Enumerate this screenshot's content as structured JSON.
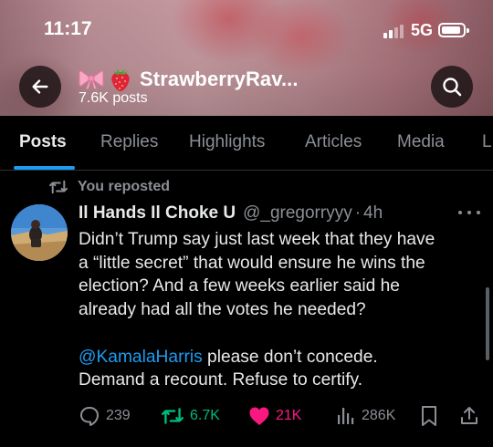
{
  "status_bar": {
    "time": "11:17",
    "network": "5G",
    "signal_bars_on": 2,
    "signal_bars_total": 4
  },
  "header": {
    "back_icon": "arrow-left-icon",
    "search_icon": "search-icon",
    "emoji_icons": [
      "bow-icon",
      "strawberry-icon"
    ],
    "profile_name": "StrawberryRav...",
    "post_count": "7.6K posts"
  },
  "tabs": [
    {
      "label": "Posts",
      "active": true
    },
    {
      "label": "Replies",
      "active": false
    },
    {
      "label": "Highlights",
      "active": false
    },
    {
      "label": "Articles",
      "active": false
    },
    {
      "label": "Media",
      "active": false
    },
    {
      "label": "L",
      "active": false
    }
  ],
  "post": {
    "repost_label": "You reposted",
    "author_name": "Il Hands Il Choke U",
    "author_handle": "@_gregorryyy",
    "separator": "·",
    "time": "4h",
    "text_lines": [
      "Didn’t Trump say just last week that they have",
      "a “little secret” that would ensure he wins the",
      "election? And a few weeks earlier said he",
      "already had all the votes he needed?"
    ],
    "mention": "@KamalaHarris",
    "line5_rest": " please don’t concede.",
    "line6": "Demand a recount. Refuse to certify.",
    "actions": {
      "replies": "239",
      "reposts": "6.7K",
      "likes": "21K",
      "views": "286K"
    }
  },
  "colors": {
    "accent": "#1d9bf0",
    "repost_green": "#00ba7c",
    "like_pink": "#f91880",
    "muted_text": "#8b8f95",
    "background": "#000000"
  }
}
